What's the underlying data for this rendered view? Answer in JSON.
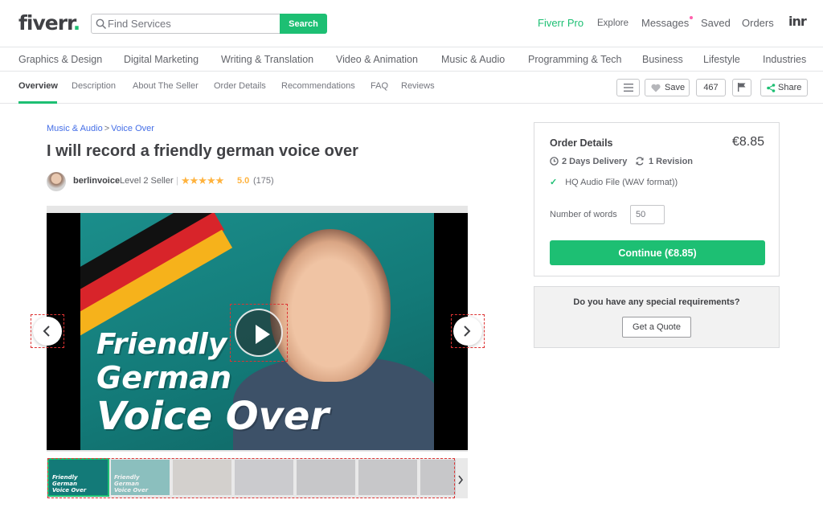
{
  "header": {
    "logo": "fiverr",
    "logo_dot": ".",
    "search_placeholder": "Find Services",
    "search_button": "Search",
    "nav": {
      "pro": "Fiverr Pro",
      "explore": "Explore",
      "messages": "Messages",
      "saved": "Saved",
      "orders": "Orders"
    },
    "avatar_text": "inr"
  },
  "categories": [
    "Graphics & Design",
    "Digital Marketing",
    "Writing & Translation",
    "Video & Animation",
    "Music & Audio",
    "Programming & Tech",
    "Business",
    "Lifestyle",
    "Industries"
  ],
  "subnav": {
    "tabs": [
      "Overview",
      "Description",
      "About The Seller",
      "Order Details",
      "Recommendations",
      "FAQ",
      "Reviews"
    ],
    "save_label": "Save",
    "save_count": "467",
    "share_label": "Share"
  },
  "gig": {
    "breadcrumb": [
      "Music & Audio",
      "Voice Over"
    ],
    "breadcrumb_sep": ">",
    "title": "I will record a friendly german voice over",
    "seller_name": "berlinvoice",
    "seller_level": "Level 2 Seller",
    "divider": "|",
    "stars": "★★★★★",
    "rating": "5.0",
    "reviews": "(175)",
    "video_text": [
      "Friendly",
      "German",
      "Voice Over"
    ],
    "thumb_text": [
      "Friendly",
      "German",
      "Voice Over"
    ]
  },
  "order": {
    "title": "Order Details",
    "price": "€8.85",
    "delivery": "2 Days Delivery",
    "revisions": "1 Revision",
    "feature": "HQ Audio File (WAV format))",
    "words_label": "Number of words",
    "words_value": "50",
    "continue": "Continue (€8.85)"
  },
  "quote": {
    "question": "Do you have any special requirements?",
    "button": "Get a Quote"
  },
  "colors": {
    "brand_green": "#1dbf73",
    "link_blue": "#446ee7",
    "star_gold": "#ffb33e"
  }
}
